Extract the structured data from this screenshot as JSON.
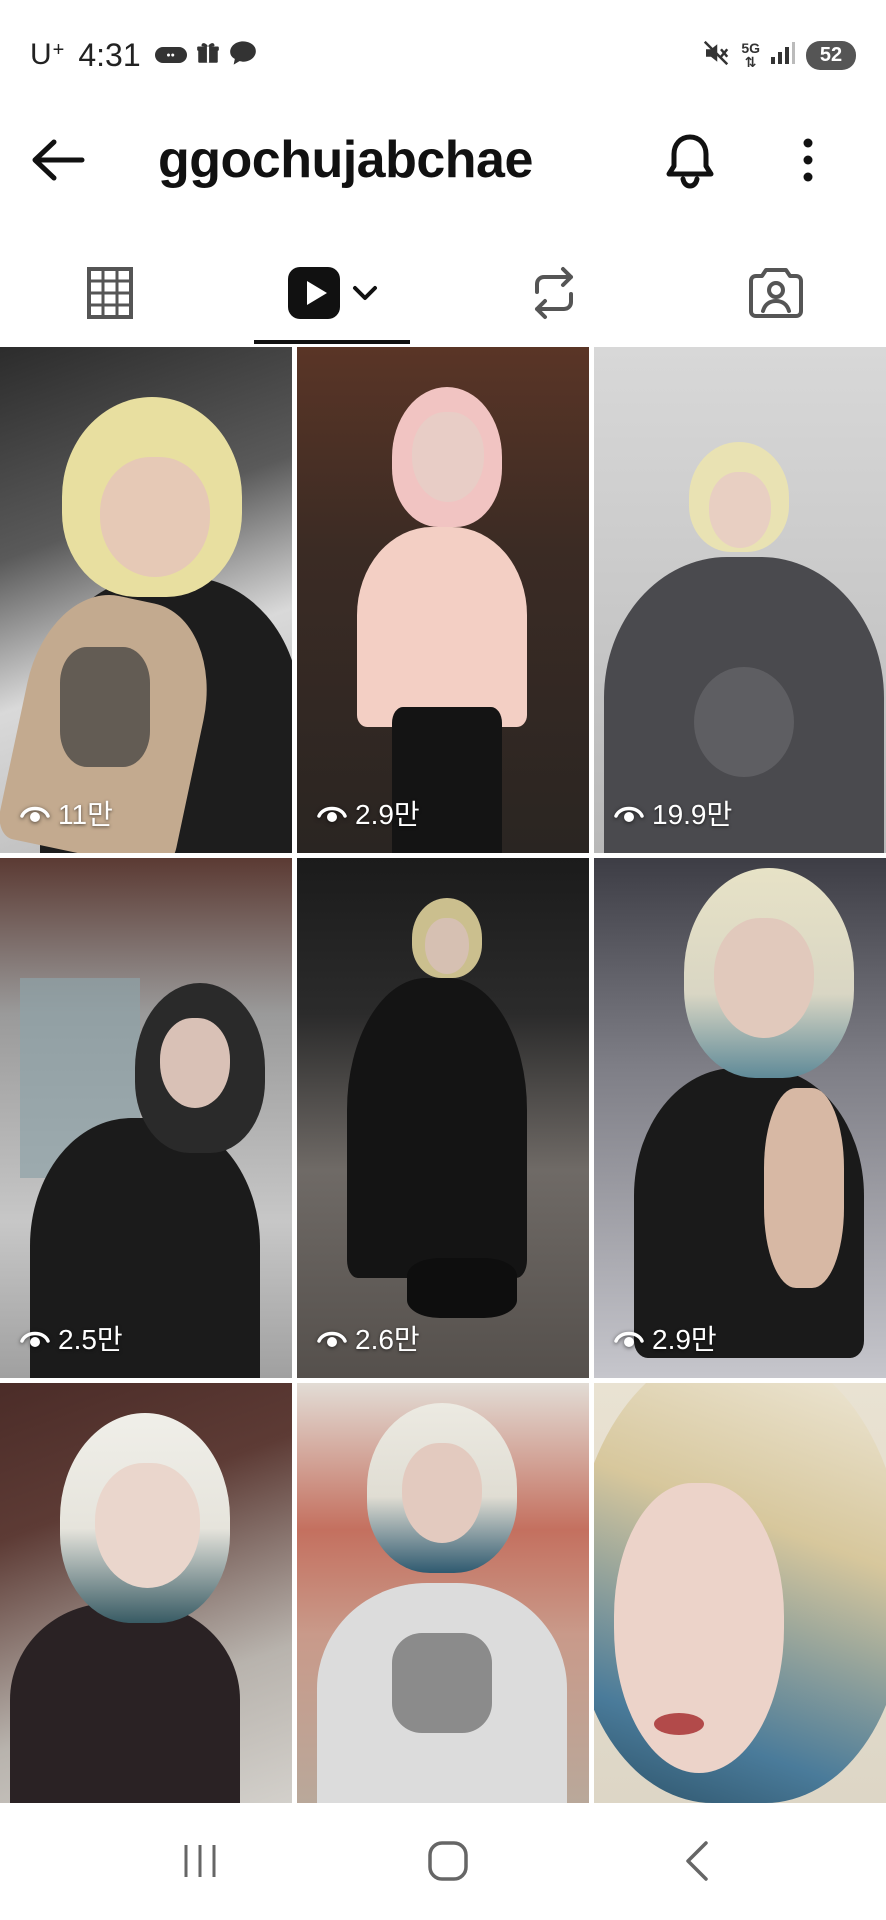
{
  "status_bar": {
    "carrier": "U",
    "carrier_sup": "+",
    "time": "4:31",
    "left_icons": [
      "spoon-app-icon",
      "gift-icon",
      "chat-bubble-icon"
    ],
    "network_top": "5G",
    "right_icons": [
      "mute-icon",
      "network-5g-icon",
      "signal-icon"
    ],
    "battery": "52"
  },
  "header": {
    "username": "ggochujabchae",
    "back_icon": "arrow-left-icon",
    "bell_icon": "bell-icon",
    "more_icon": "more-vertical-icon"
  },
  "tabs": [
    {
      "name": "posts",
      "icon": "grid-icon",
      "selected": false
    },
    {
      "name": "reels",
      "icon": "play-icon",
      "selected": true
    },
    {
      "name": "reposts",
      "icon": "repost-icon",
      "selected": false
    },
    {
      "name": "tagged",
      "icon": "tagged-person-icon",
      "selected": false
    }
  ],
  "reels": [
    {
      "views": "11만"
    },
    {
      "views": "2.9만"
    },
    {
      "views": "19.9만"
    },
    {
      "views": "2.5만"
    },
    {
      "views": "2.6만"
    },
    {
      "views": "2.9만"
    },
    {
      "views": ""
    },
    {
      "views": ""
    },
    {
      "views": ""
    }
  ],
  "colors": {
    "background": "#ffffff",
    "text": "#111111",
    "indicator": "#111111",
    "icon_gray": "#555555"
  },
  "nav_bar": {
    "icons": [
      "recents-icon",
      "home-icon",
      "back-icon"
    ]
  }
}
